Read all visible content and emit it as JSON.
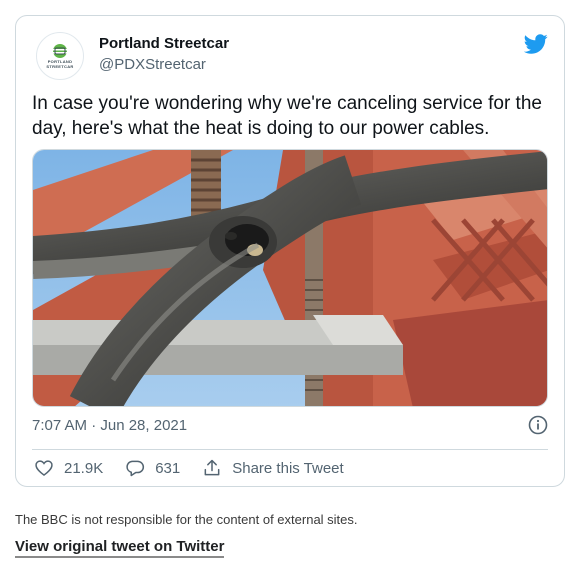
{
  "tweet": {
    "display_name": "Portland Streetcar",
    "handle": "@PDXStreetcar",
    "avatar_text": [
      "PORTLAND",
      "STREETCAR"
    ],
    "text": "In case you're wondering why we're canceling service for the day, here's what the heat is doing to our power cables.",
    "timestamp": "7:07 AM · Jun 28, 2021",
    "likes": "21.9K",
    "replies": "631",
    "share_label": "Share this Tweet",
    "colors": {
      "twitter_blue": "#1d9bf0",
      "muted": "#536471",
      "border": "#cfd9de",
      "logo_green": "#5fb547"
    },
    "icons": [
      "twitter-bird-icon",
      "info-icon",
      "heart-icon",
      "reply-icon",
      "share-icon"
    ]
  },
  "footer": {
    "disclaimer": "The BBC is not responsible for the content of external sites.",
    "link_label": "View original tweet on Twitter"
  }
}
